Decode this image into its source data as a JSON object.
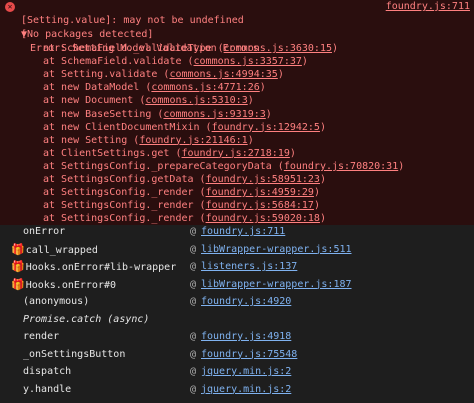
{
  "error": {
    "title": "Error: Setting Model Validation Errors",
    "source": "foundry.js:711",
    "messages": [
      "[Setting.value]: may not be undefined",
      "[No packages detected]"
    ],
    "stack": [
      {
        "pre": "at SchemaField._validateType (",
        "link": "commons.js:3630:15",
        "post": ")"
      },
      {
        "pre": "at SchemaField.validate (",
        "link": "commons.js:3357:37",
        "post": ")"
      },
      {
        "pre": "at Setting.validate (",
        "link": "commons.js:4994:35",
        "post": ")"
      },
      {
        "pre": "at new DataModel (",
        "link": "commons.js:4771:26",
        "post": ")"
      },
      {
        "pre": "at new Document (",
        "link": "commons.js:5310:3",
        "post": ")"
      },
      {
        "pre": "at new BaseSetting (",
        "link": "commons.js:9319:3",
        "post": ")"
      },
      {
        "pre": "at new ClientDocumentMixin (",
        "link": "foundry.js:12942:5",
        "post": ")"
      },
      {
        "pre": "at new Setting (",
        "link": "foundry.js:21146:1",
        "post": ")"
      },
      {
        "pre": "at ClientSettings.get (",
        "link": "foundry.js:2718:19",
        "post": ")"
      },
      {
        "pre": "at SettingsConfig._prepareCategoryData (",
        "link": "foundry.js:70820:31",
        "post": ")"
      },
      {
        "pre": "at SettingsConfig.getData (",
        "link": "foundry.js:58951:23",
        "post": ")"
      },
      {
        "pre": "at SettingsConfig._render (",
        "link": "foundry.js:4959:29",
        "post": ")"
      },
      {
        "pre": "at SettingsConfig._render (",
        "link": "foundry.js:5684:17",
        "post": ")"
      },
      {
        "pre": "at SettingsConfig._render (",
        "link": "foundry.js:59020:18",
        "post": ")"
      }
    ]
  },
  "call_stack": [
    {
      "fn": "onError",
      "gift": false,
      "at": "@",
      "link": "foundry.js:711"
    },
    {
      "fn": "call_wrapped",
      "gift": true,
      "at": "@",
      "link": "libWrapper-wrapper.js:511"
    },
    {
      "fn": "Hooks.onError#lib-wrapper",
      "gift": true,
      "at": "@",
      "link": "listeners.js:137"
    },
    {
      "fn": "Hooks.onError#0",
      "gift": true,
      "at": "@",
      "link": "libWrapper-wrapper.js:187"
    },
    {
      "fn": "(anonymous)",
      "gift": false,
      "at": "@",
      "link": "foundry.js:4920"
    },
    {
      "async": "Promise.catch (async)"
    },
    {
      "fn": "render",
      "gift": false,
      "at": "@",
      "link": "foundry.js:4918"
    },
    {
      "fn": "_onSettingsButton",
      "gift": false,
      "at": "@",
      "link": "foundry.js:75548"
    },
    {
      "fn": "dispatch",
      "gift": false,
      "at": "@",
      "link": "jquery.min.js:2"
    },
    {
      "fn": "y.handle",
      "gift": false,
      "at": "@",
      "link": "jquery.min.js:2"
    }
  ],
  "colors": {
    "error_bg": "#2a0e0e",
    "error_text": "#ff8080",
    "link_blue": "#7fb2f0",
    "gift": "#e8b02a"
  },
  "icons": {
    "error": "error-circle-icon",
    "expand": "caret-down-icon",
    "wrapper": "gift-icon"
  }
}
